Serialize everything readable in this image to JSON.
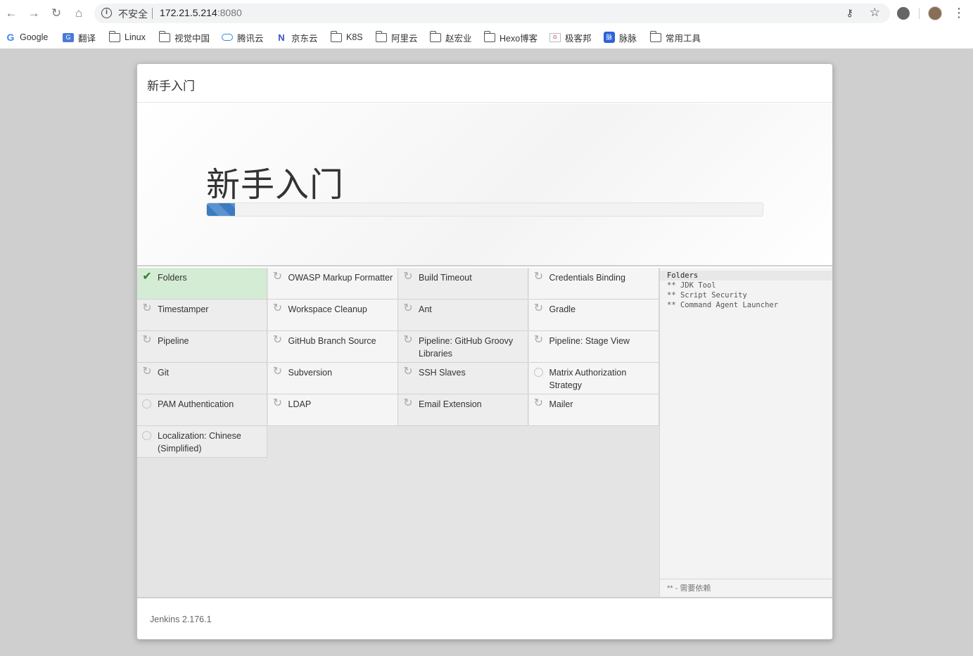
{
  "browser": {
    "security_label": "不安全",
    "url_host": "172.21.5.214",
    "url_port": ":8080",
    "bookmarks": [
      {
        "label": "Google",
        "icon": "google-icon"
      },
      {
        "label": "翻译",
        "icon": "translate-icon"
      },
      {
        "label": "Linux",
        "icon": "folder-icon"
      },
      {
        "label": "视觉中国",
        "icon": "folder-icon"
      },
      {
        "label": "腾讯云",
        "icon": "cloud-icon"
      },
      {
        "label": "京东云",
        "icon": "jd-cloud-icon"
      },
      {
        "label": "K8S",
        "icon": "folder-icon"
      },
      {
        "label": "阿里云",
        "icon": "folder-icon"
      },
      {
        "label": "赵宏业",
        "icon": "folder-icon"
      },
      {
        "label": "Hexo博客",
        "icon": "folder-icon"
      },
      {
        "label": "极客邦",
        "icon": "geekbang-icon"
      },
      {
        "label": "脉脉",
        "icon": "maimai-icon"
      },
      {
        "label": "常用工具",
        "icon": "folder-icon"
      }
    ]
  },
  "dialog": {
    "header_title": "新手入门",
    "hero_title": "新手入门",
    "progress_percent": 5,
    "plugins": [
      {
        "label": "Folders",
        "status": "done"
      },
      {
        "label": "OWASP Markup Formatter",
        "status": "pending"
      },
      {
        "label": "Build Timeout",
        "status": "pending"
      },
      {
        "label": "Credentials Binding",
        "status": "pending"
      },
      {
        "label": "Timestamper",
        "status": "pending"
      },
      {
        "label": "Workspace Cleanup",
        "status": "pending"
      },
      {
        "label": "Ant",
        "status": "pending"
      },
      {
        "label": "Gradle",
        "status": "pending"
      },
      {
        "label": "Pipeline",
        "status": "installing"
      },
      {
        "label": "GitHub Branch Source",
        "status": "pending"
      },
      {
        "label": "Pipeline: GitHub Groovy Libraries",
        "status": "installing"
      },
      {
        "label": "Pipeline: Stage View",
        "status": "pending"
      },
      {
        "label": "Git",
        "status": "pending"
      },
      {
        "label": "Subversion",
        "status": "pending"
      },
      {
        "label": "SSH Slaves",
        "status": "pending"
      },
      {
        "label": "Matrix Authorization Strategy",
        "status": "not-started"
      },
      {
        "label": "PAM Authentication",
        "status": "not-started"
      },
      {
        "label": "LDAP",
        "status": "pending"
      },
      {
        "label": "Email Extension",
        "status": "pending"
      },
      {
        "label": "Mailer",
        "status": "pending"
      },
      {
        "label": "Localization: Chinese (Simplified)",
        "status": "not-started"
      }
    ],
    "log_lines": [
      "Folders",
      "** JDK Tool",
      "** Script Security",
      "** Command Agent Launcher"
    ],
    "log_footer": "** - 需要依赖",
    "version": "Jenkins 2.176.1"
  }
}
